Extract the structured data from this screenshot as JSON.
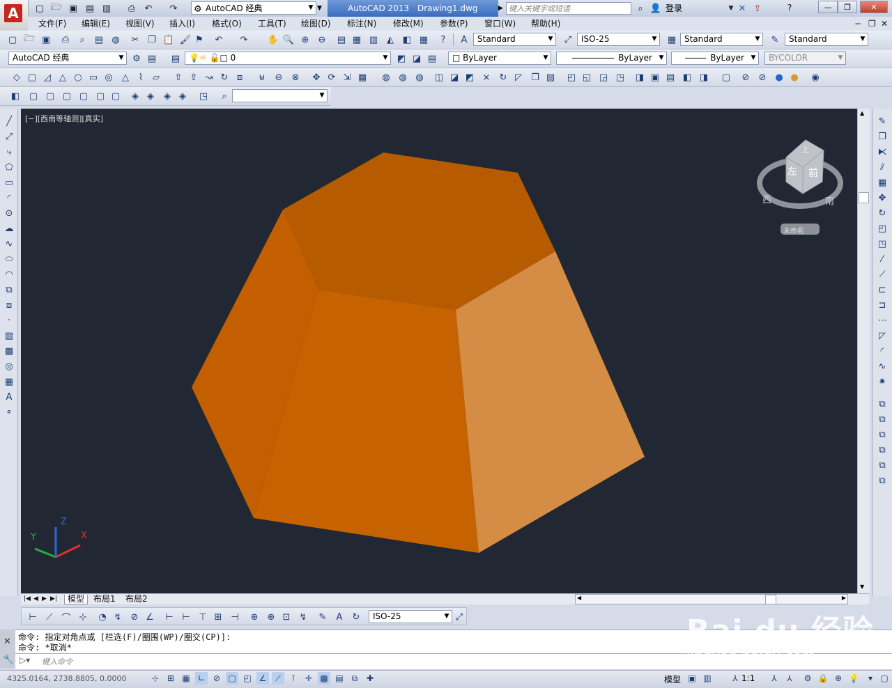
{
  "app": {
    "title": "AutoCAD 2013",
    "document": "Drawing1.dwg"
  },
  "workspace": "AutoCAD 经典",
  "search": {
    "placeholder": "键入关键字或短语"
  },
  "user": {
    "login": "登录"
  },
  "menu": [
    {
      "label": "文件(F)"
    },
    {
      "label": "编辑(E)"
    },
    {
      "label": "视图(V)"
    },
    {
      "label": "插入(I)"
    },
    {
      "label": "格式(O)"
    },
    {
      "label": "工具(T)"
    },
    {
      "label": "绘图(D)"
    },
    {
      "label": "标注(N)"
    },
    {
      "label": "修改(M)"
    },
    {
      "label": "参数(P)"
    },
    {
      "label": "窗口(W)"
    },
    {
      "label": "帮助(H)"
    }
  ],
  "styles": {
    "text_style": "Standard",
    "dim_style": "ISO-25",
    "table_style": "Standard",
    "mleader_style": "Standard"
  },
  "layers": {
    "workspace": "AutoCAD 经典",
    "current_layer": "0",
    "color": "ByLayer",
    "linetype": "ByLayer",
    "lineweight": "ByLayer",
    "plotstyle": "BYCOLOR"
  },
  "viewport": {
    "label": "[−][西南等轴测][真实]",
    "background": "#212833"
  },
  "viewcube": {
    "top": "上",
    "left": "左",
    "front": "前",
    "west": "西",
    "south": "南",
    "named": "未命名"
  },
  "solid": {
    "color_top": "#b75b00",
    "color_left": "#c45f00",
    "color_front": "#c66200",
    "color_right": "#d58c45"
  },
  "tabs": {
    "model": "模型",
    "layout1": "布局1",
    "layout2": "布局2"
  },
  "dimbar": {
    "style": "ISO-25"
  },
  "command": {
    "line1": "命令: 指定对角点或 [栏选(F)/圈围(WP)/圈交(CP)]:",
    "line2": "命令: *取消*",
    "placeholder": "键入命令"
  },
  "status": {
    "coords": "4325.0164, 2738.8805, 0.0000",
    "model": "模型",
    "scale": "1:1"
  },
  "watermark": {
    "brand": "Bai du 经验",
    "url": "jingyan.baidu.com"
  }
}
